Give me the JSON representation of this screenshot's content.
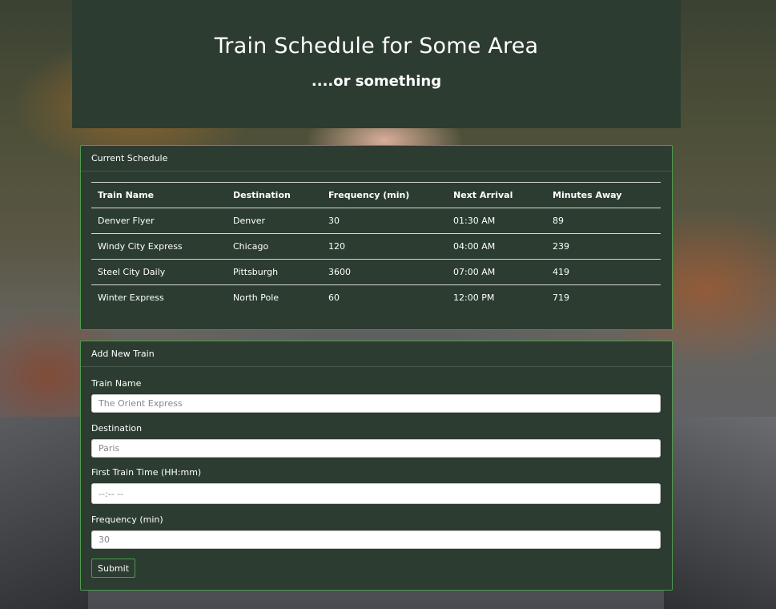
{
  "header": {
    "title": "Train Schedule for Some Area",
    "subtitle": "....or something"
  },
  "schedule": {
    "heading": "Current Schedule",
    "columns": [
      "Train Name",
      "Destination",
      "Frequency (min)",
      "Next Arrival",
      "Minutes Away"
    ],
    "rows": [
      [
        "Denver Flyer",
        "Denver",
        "30",
        "01:30 AM",
        "89"
      ],
      [
        "Windy City Express",
        "Chicago",
        "120",
        "04:00 AM",
        "239"
      ],
      [
        "Steel City Daily",
        "Pittsburgh",
        "3600",
        "07:00 AM",
        "419"
      ],
      [
        "Winter Express",
        "North Pole",
        "60",
        "12:00 PM",
        "719"
      ]
    ]
  },
  "form": {
    "heading": "Add New Train",
    "train_name": {
      "label": "Train Name",
      "placeholder": "The Orient Express"
    },
    "destination": {
      "label": "Destination",
      "placeholder": "Paris"
    },
    "first_time": {
      "label": "First Train Time (HH:mm)",
      "placeholder": "--:-- --"
    },
    "frequency": {
      "label": "Frequency (min)",
      "placeholder": "30"
    },
    "submit_label": "Submit"
  }
}
